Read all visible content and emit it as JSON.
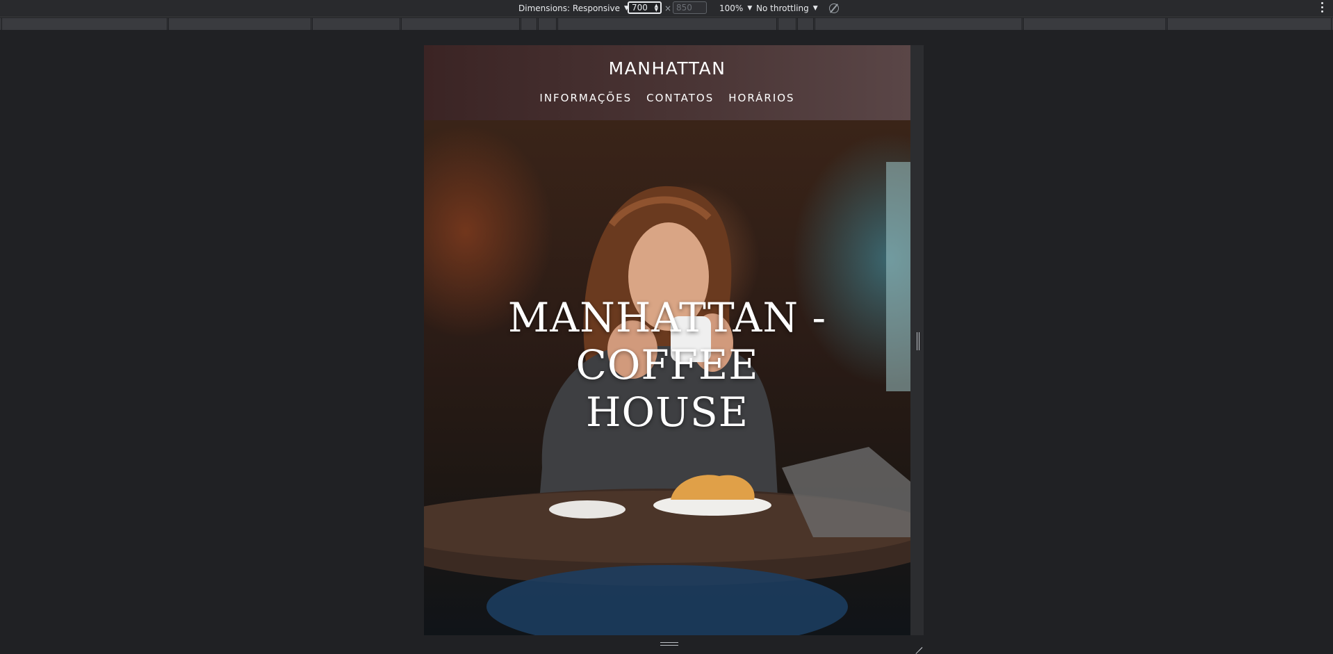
{
  "devtools": {
    "dimensions_label": "Dimensions: Responsive",
    "width_value": "700",
    "height_placeholder": "850",
    "times_symbol": "×",
    "zoom_label": "100%",
    "throttling_label": "No throttling"
  },
  "site": {
    "brand": "MANHATTAN",
    "nav": [
      "INFORMAÇÕES",
      "CONTATOS",
      "HORÁRIOS"
    ],
    "hero_title_line1": "MANHATTAN - COFFEE",
    "hero_title_line2": "HOUSE"
  },
  "colors": {
    "devtools_background": "#202124",
    "toolbar_background": "#292a2d",
    "header_gradient_start": "#3b2424",
    "header_gradient_end": "#5a4647"
  }
}
